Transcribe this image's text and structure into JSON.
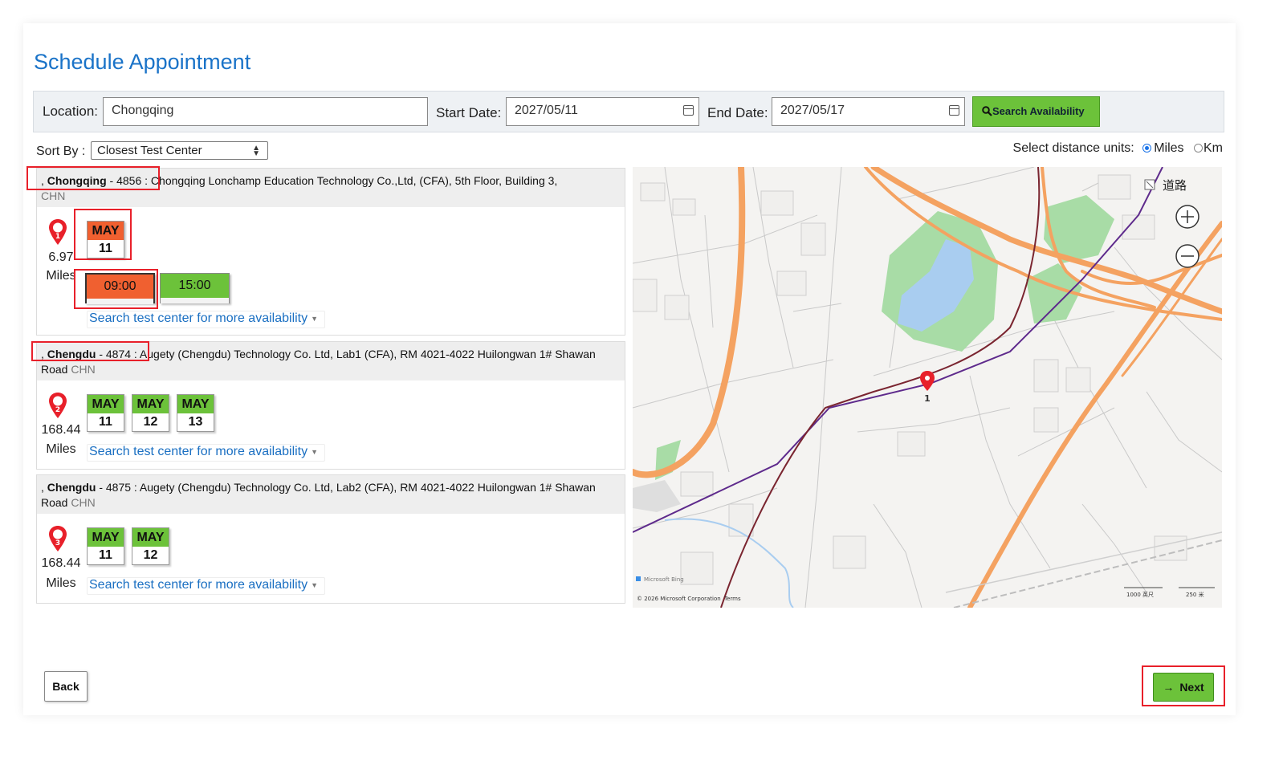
{
  "page": {
    "title": "Schedule Appointment"
  },
  "search": {
    "location_label": "Location:",
    "location_value": "Chongqing",
    "start_label": "Start Date:",
    "start_value": "2027/05/11",
    "end_label": "End Date:",
    "end_value": "2027/05/17",
    "button_label": "Search Availability"
  },
  "sort": {
    "label": "Sort By :",
    "selected": "Closest Test Center"
  },
  "units": {
    "label": "Select distance units:",
    "miles": "Miles",
    "km": "Km",
    "selected": "Miles"
  },
  "centers": [
    {
      "prefix": ", ",
      "city": "Chongqing",
      "code": " - 4856 :",
      "address": " Chongqing Lonchamp Education Technology Co.,Ltd, (CFA), 5th Floor, Building 3,",
      "country": "CHN",
      "pin_number": "1",
      "distance": "6.97",
      "unit": "Miles",
      "dates": [
        {
          "month": "MAY",
          "day": "11"
        }
      ],
      "times": [
        "09:00",
        "15:00"
      ],
      "more_link": "Search test center for more availability"
    },
    {
      "prefix": ", ",
      "city": "Chengdu",
      "code": " - 4874 :",
      "address": " Augety (Chengdu) Technology Co. Ltd, Lab1 (CFA), RM 4021-4022 Huilongwan 1# Shawan Road",
      "country": "CHN",
      "pin_number": "2",
      "distance": "168.44",
      "unit": "Miles",
      "dates": [
        {
          "month": "MAY",
          "day": "11"
        },
        {
          "month": "MAY",
          "day": "12"
        },
        {
          "month": "MAY",
          "day": "13"
        }
      ],
      "more_link": "Search test center for more availability"
    },
    {
      "prefix": ", ",
      "city": "Chengdu",
      "code": " - 4875 :",
      "address": " Augety (Chengdu) Technology Co. Ltd, Lab2 (CFA), RM 4021-4022 Huilongwan 1# Shawan Road",
      "country": "CHN",
      "pin_number": "3",
      "distance": "168.44",
      "unit": "Miles",
      "dates": [
        {
          "month": "MAY",
          "day": "11"
        },
        {
          "month": "MAY",
          "day": "12"
        }
      ],
      "more_link": "Search test center for more availability"
    }
  ],
  "map": {
    "layer_label": "道路",
    "pin_label": "1",
    "copyright": "© 2026 Microsoft Corporation",
    "terms": "Terms",
    "brand": "Microsoft Bing",
    "scale_1": "1000 英尺",
    "scale_2": "250 米"
  },
  "nav": {
    "back": "Back",
    "next": "Next"
  },
  "colors": {
    "accent_blue": "#1a73c8",
    "available_green": "#6cc23a",
    "selected_orange": "#f06030",
    "highlight_red": "#e8202a"
  }
}
